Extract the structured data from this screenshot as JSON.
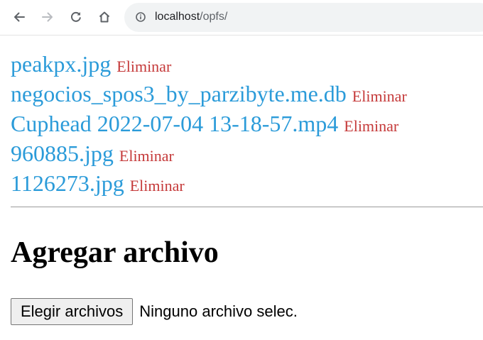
{
  "browser": {
    "url_host": "localhost",
    "url_path": "/opfs/",
    "icons": {
      "back": "arrow-left-icon",
      "forward": "arrow-right-icon",
      "reload": "reload-icon",
      "home": "home-icon",
      "site_info": "info-circle-icon"
    }
  },
  "files": {
    "delete_label": "Eliminar",
    "items": [
      {
        "name": "peakpx.jpg",
        "action": "Eliminar"
      },
      {
        "name": "negocios_spos3_by_parzibyte.me.db",
        "action": "Eliminar"
      },
      {
        "name": "Cuphead 2022-07-04 13-18-57.mp4",
        "action": "Eliminar"
      },
      {
        "name": "960885.jpg",
        "action": "Eliminar"
      },
      {
        "name": "1126273.jpg",
        "action": "Eliminar"
      }
    ]
  },
  "upload": {
    "title": "Agregar archivo",
    "button_label": "Elegir archivos",
    "no_file_text": "Ninguno archivo selec."
  },
  "colors": {
    "file_link": "#2b9bd9",
    "delete_link": "#c53a3a",
    "omnibox_bg": "#f1f3f4"
  }
}
